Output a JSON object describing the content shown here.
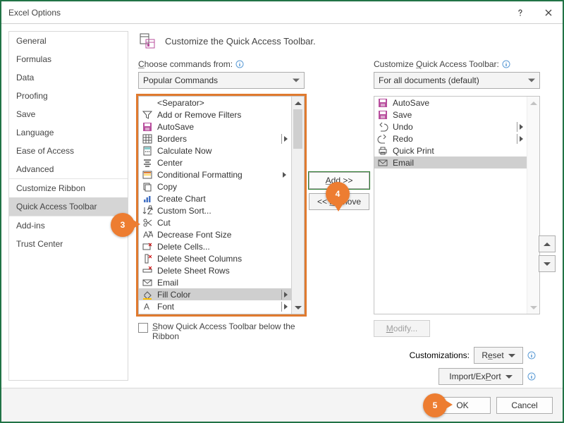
{
  "window": {
    "title": "Excel Options"
  },
  "sidebar": {
    "items": [
      {
        "label": "General"
      },
      {
        "label": "Formulas"
      },
      {
        "label": "Data"
      },
      {
        "label": "Proofing"
      },
      {
        "label": "Save"
      },
      {
        "label": "Language"
      },
      {
        "label": "Ease of Access"
      },
      {
        "label": "Advanced"
      },
      {
        "label": "Customize Ribbon"
      },
      {
        "label": "Quick Access Toolbar"
      },
      {
        "label": "Add-ins"
      },
      {
        "label": "Trust Center"
      }
    ],
    "selected_index": 9
  },
  "page": {
    "title": "Customize the Quick Access Toolbar."
  },
  "left_panel": {
    "label_pre": "",
    "label_underlined": "C",
    "label_post": "hoose commands from:",
    "combo_value": "Popular Commands",
    "items": [
      {
        "label": "<Separator>",
        "icon": "separator"
      },
      {
        "label": "Add or Remove Filters",
        "icon": "funnel"
      },
      {
        "label": "AutoSave",
        "icon": "disk-pink"
      },
      {
        "label": "Borders",
        "icon": "grid",
        "submenu": true,
        "submenubar": true
      },
      {
        "label": "Calculate Now",
        "icon": "calc"
      },
      {
        "label": "Center",
        "icon": "center"
      },
      {
        "label": "Conditional Formatting",
        "icon": "cond",
        "submenu": true
      },
      {
        "label": "Copy",
        "icon": "copy"
      },
      {
        "label": "Create Chart",
        "icon": "chart"
      },
      {
        "label": "Custom Sort...",
        "icon": "sort"
      },
      {
        "label": "Cut",
        "icon": "scissors"
      },
      {
        "label": "Decrease Font Size",
        "icon": "font-dec"
      },
      {
        "label": "Delete Cells...",
        "icon": "del-cell"
      },
      {
        "label": "Delete Sheet Columns",
        "icon": "del-col"
      },
      {
        "label": "Delete Sheet Rows",
        "icon": "del-row"
      },
      {
        "label": "Email",
        "icon": "mail"
      },
      {
        "label": "Fill Color",
        "icon": "bucket",
        "submenu": true,
        "submenubar": true,
        "selected": true
      },
      {
        "label": "Font",
        "icon": "font",
        "submenu": true,
        "submenubar": true
      }
    ]
  },
  "right_panel": {
    "label_pre": "Customize ",
    "label_underlined": "Q",
    "label_post": "uick Access Toolbar:",
    "combo_value": "For all documents (default)",
    "items": [
      {
        "label": "AutoSave",
        "icon": "disk-pink"
      },
      {
        "label": "Save",
        "icon": "disk-pink"
      },
      {
        "label": "Undo",
        "icon": "undo",
        "submenubar": true
      },
      {
        "label": "Redo",
        "icon": "redo",
        "submenubar": true
      },
      {
        "label": "Quick Print",
        "icon": "print"
      },
      {
        "label": "Email",
        "icon": "mail",
        "selected": true
      }
    ]
  },
  "mid": {
    "add": "Add >>",
    "add_u": "A",
    "remove": "<< Remove",
    "remove_u": "R"
  },
  "below_left": {
    "checkbox_pre": "S",
    "checkbox_post": "how Quick Access Toolbar below the Ribbon",
    "checked": false
  },
  "below_right": {
    "modify": "Modify...",
    "customizations_label": "Customizations:",
    "reset": "Reset",
    "reset_u": "e",
    "import_export": "Import/Export",
    "import_export_u": "P"
  },
  "footer": {
    "ok": "OK",
    "cancel": "Cancel"
  },
  "callouts": {
    "c3": "3",
    "c4": "4",
    "c5": "5"
  },
  "icons": {
    "separator": "",
    "funnel": "",
    "disk-pink": "",
    "grid": "",
    "calc": "",
    "center": "",
    "cond": "",
    "copy": "",
    "chart": "",
    "sort": "",
    "scissors": "",
    "font-dec": "",
    "del-cell": "",
    "del-col": "",
    "del-row": "",
    "mail": "",
    "bucket": "",
    "font": "",
    "undo": "",
    "redo": "",
    "print": ""
  }
}
